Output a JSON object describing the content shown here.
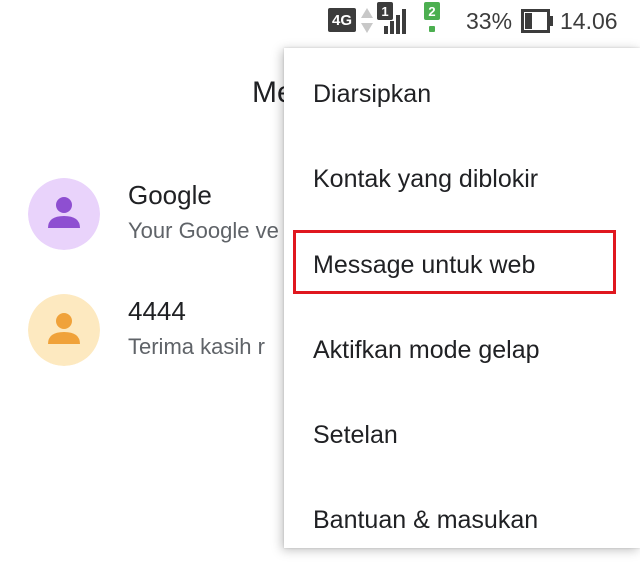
{
  "status_bar": {
    "network": "4G",
    "sim1": "1",
    "sim2": "2",
    "battery": "33%",
    "time": "14.06",
    "icons": [
      "network-4g-icon",
      "data-arrows-icon",
      "signal-icon",
      "battery-icon"
    ]
  },
  "app": {
    "title_partial": "Me"
  },
  "conversations": [
    {
      "name": "Google",
      "snippet": "Your Google ve",
      "avatar_color": "#e9d3fb",
      "person_color": "#8e4fd1"
    },
    {
      "name": "4444",
      "snippet": "Terima kasih r",
      "avatar_color": "#fde9c0",
      "person_color": "#f0a23a"
    }
  ],
  "menu": {
    "items": [
      {
        "label": "Diarsipkan"
      },
      {
        "label": "Kontak yang diblokir"
      },
      {
        "label": "Message untuk web"
      },
      {
        "label": "Aktifkan mode gelap"
      },
      {
        "label": "Setelan"
      },
      {
        "label": "Bantuan & masukan"
      }
    ],
    "highlighted_index": 2,
    "highlight_color": "#e0171f"
  }
}
